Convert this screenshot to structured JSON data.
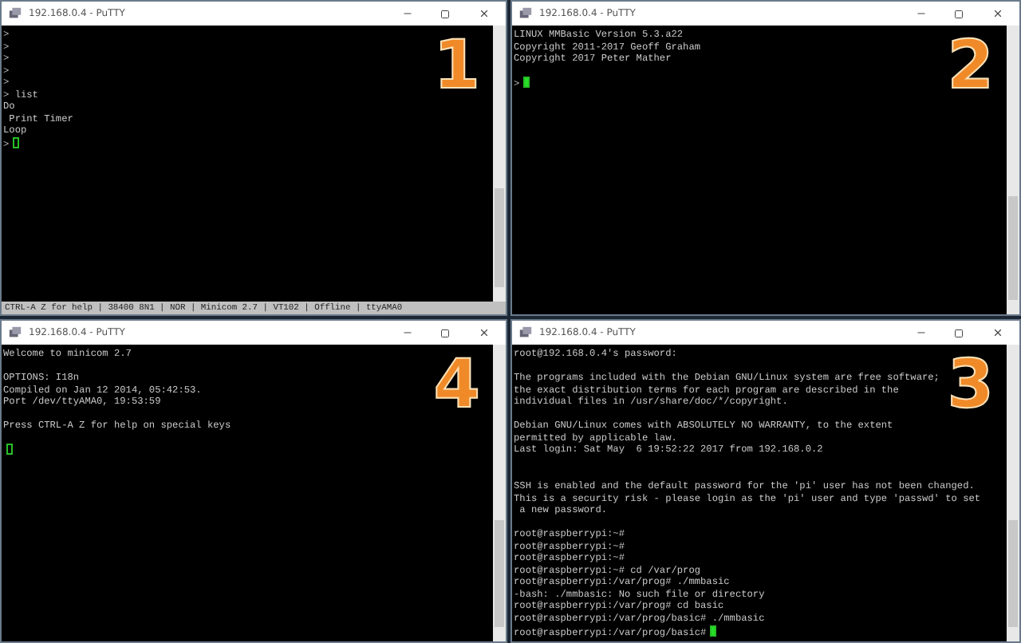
{
  "windows": [
    {
      "title": "192.168.0.4 - PuTTY",
      "number": "1",
      "lines": [
        {
          "kind": "text",
          "text": ">"
        },
        {
          "kind": "text",
          "text": ">"
        },
        {
          "kind": "text",
          "text": ">"
        },
        {
          "kind": "text",
          "text": ">"
        },
        {
          "kind": "text",
          "text": ">"
        },
        {
          "kind": "text",
          "text": "> list"
        },
        {
          "kind": "text",
          "text": "Do"
        },
        {
          "kind": "text",
          "text": " Print Timer"
        },
        {
          "kind": "text",
          "text": "Loop"
        }
      ],
      "cursor": {
        "prompt": ">",
        "filled": false
      },
      "status_bar": "CTRL-A Z for help | 38400 8N1 | NOR | Minicom 2.7 | VT102 | Offline | ttyAMA0"
    },
    {
      "title": "192.168.0.4 - PuTTY",
      "number": "2",
      "lines": [
        {
          "kind": "text",
          "text": "LINUX MMBasic Version 5.3.a22"
        },
        {
          "kind": "text",
          "text": "Copyright 2011-2017 Geoff Graham"
        },
        {
          "kind": "text",
          "text": "Copyright 2017 Peter Mather"
        },
        {
          "kind": "blank"
        }
      ],
      "cursor": {
        "prompt": ">",
        "filled": true
      }
    },
    {
      "title": "192.168.0.4 - PuTTY",
      "number": "4",
      "lines": [
        {
          "kind": "text",
          "text": "Welcome to minicom 2.7"
        },
        {
          "kind": "blank"
        },
        {
          "kind": "text",
          "text": "OPTIONS: I18n"
        },
        {
          "kind": "text",
          "text": "Compiled on Jan 12 2014, 05:42:53."
        },
        {
          "kind": "text",
          "text": "Port /dev/ttyAMA0, 19:53:59"
        },
        {
          "kind": "blank"
        },
        {
          "kind": "text",
          "text": "Press CTRL-A Z for help on special keys"
        },
        {
          "kind": "blank"
        }
      ],
      "cursor": {
        "filled": false
      }
    },
    {
      "title": "192.168.0.4 - PuTTY",
      "number": "3",
      "lines": [
        {
          "kind": "text",
          "text": "root@192.168.0.4's password:"
        },
        {
          "kind": "blank"
        },
        {
          "kind": "text",
          "text": "The programs included with the Debian GNU/Linux system are free software;"
        },
        {
          "kind": "text",
          "text": "the exact distribution terms for each program are described in the"
        },
        {
          "kind": "text",
          "text": "individual files in /usr/share/doc/*/copyright."
        },
        {
          "kind": "blank"
        },
        {
          "kind": "text",
          "text": "Debian GNU/Linux comes with ABSOLUTELY NO WARRANTY, to the extent"
        },
        {
          "kind": "text",
          "text": "permitted by applicable law."
        },
        {
          "kind": "text",
          "text": "Last login: Sat May  6 19:52:22 2017 from 192.168.0.2"
        },
        {
          "kind": "blank"
        },
        {
          "kind": "blank"
        },
        {
          "kind": "text",
          "text": "SSH is enabled and the default password for the 'pi' user has not been changed."
        },
        {
          "kind": "text",
          "text": "This is a security risk - please login as the 'pi' user and type 'passwd' to set"
        },
        {
          "kind": "text",
          "text": " a new password."
        },
        {
          "kind": "blank"
        },
        {
          "kind": "text",
          "text": "root@raspberrypi:~#"
        },
        {
          "kind": "text",
          "text": "root@raspberrypi:~#"
        },
        {
          "kind": "text",
          "text": "root@raspberrypi:~#"
        },
        {
          "kind": "text",
          "text": "root@raspberrypi:~# cd /var/prog"
        },
        {
          "kind": "text",
          "text": "root@raspberrypi:/var/prog# ./mmbasic"
        },
        {
          "kind": "text",
          "text": "-bash: ./mmbasic: No such file or directory"
        },
        {
          "kind": "text",
          "text": "root@raspberrypi:/var/prog# cd basic"
        },
        {
          "kind": "text",
          "text": "root@raspberrypi:/var/prog/basic# ./mmbasic"
        }
      ],
      "cursor": {
        "prompt": "root@raspberrypi:/var/prog/basic#",
        "filled": true
      }
    }
  ]
}
